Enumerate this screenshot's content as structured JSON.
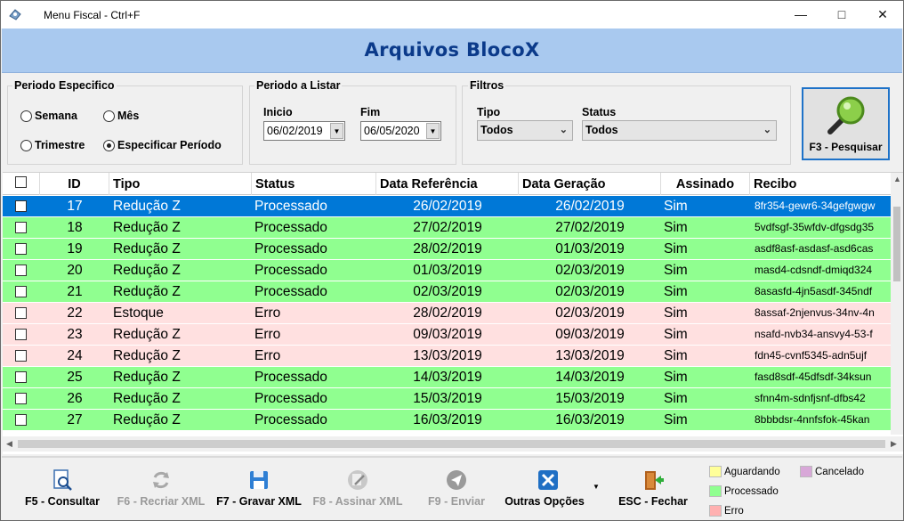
{
  "window": {
    "title": "Menu Fiscal - Ctrl+F",
    "controls": [
      "minimize",
      "maximize",
      "close"
    ]
  },
  "header": {
    "title": "Arquivos BlocoX"
  },
  "filters": {
    "periodo_especifico": {
      "label": "Periodo Especifico",
      "options": [
        {
          "label": "Semana",
          "checked": false
        },
        {
          "label": "Mês",
          "checked": false
        },
        {
          "label": "Trimestre",
          "checked": false
        },
        {
          "label": "Especificar Período",
          "checked": true
        }
      ]
    },
    "periodo_listar": {
      "label": "Periodo a Listar",
      "inicio_label": "Inicio",
      "inicio_value": "06/02/2019",
      "fim_label": "Fim",
      "fim_value": "06/05/2020"
    },
    "filtros": {
      "label": "Filtros",
      "tipo_label": "Tipo",
      "tipo_value": "Todos",
      "status_label": "Status",
      "status_value": "Todos"
    },
    "search_button": {
      "label": "F3 - Pesquisar",
      "icon": "magnifier-icon"
    }
  },
  "grid": {
    "columns": [
      "ID",
      "Tipo",
      "Status",
      "Data Referência",
      "Data Geração",
      "Assinado",
      "Recibo"
    ],
    "rows": [
      {
        "id": "17",
        "tipo": "Redução Z",
        "status": "Processado",
        "ref": "26/02/2019",
        "ger": "26/02/2019",
        "assinado": "Sim",
        "recibo": "8fr354-gewr6-34gefgwgw",
        "selected": true
      },
      {
        "id": "18",
        "tipo": "Redução Z",
        "status": "Processado",
        "ref": "27/02/2019",
        "ger": "27/02/2019",
        "assinado": "Sim",
        "recibo": "5vdfsgf-35wfdv-dfgsdg35"
      },
      {
        "id": "19",
        "tipo": "Redução Z",
        "status": "Processado",
        "ref": "28/02/2019",
        "ger": "01/03/2019",
        "assinado": "Sim",
        "recibo": "asdf8asf-asdasf-asd6cas"
      },
      {
        "id": "20",
        "tipo": "Redução Z",
        "status": "Processado",
        "ref": "01/03/2019",
        "ger": "02/03/2019",
        "assinado": "Sim",
        "recibo": "masd4-cdsndf-dmiqd324"
      },
      {
        "id": "21",
        "tipo": "Redução Z",
        "status": "Processado",
        "ref": "02/03/2019",
        "ger": "02/03/2019",
        "assinado": "Sim",
        "recibo": "8asasfd-4jn5asdf-345ndf"
      },
      {
        "id": "22",
        "tipo": "Estoque",
        "status": "Erro",
        "ref": "28/02/2019",
        "ger": "02/03/2019",
        "assinado": "Sim",
        "recibo": "8assaf-2njenvus-34nv-4n"
      },
      {
        "id": "23",
        "tipo": "Redução Z",
        "status": "Erro",
        "ref": "09/03/2019",
        "ger": "09/03/2019",
        "assinado": "Sim",
        "recibo": "nsafd-nvb34-ansvy4-53-f"
      },
      {
        "id": "24",
        "tipo": "Redução Z",
        "status": "Erro",
        "ref": "13/03/2019",
        "ger": "13/03/2019",
        "assinado": "Sim",
        "recibo": "fdn45-cvnf5345-adn5ujf"
      },
      {
        "id": "25",
        "tipo": "Redução Z",
        "status": "Processado",
        "ref": "14/03/2019",
        "ger": "14/03/2019",
        "assinado": "Sim",
        "recibo": "fasd8sdf-45dfsdf-34ksun"
      },
      {
        "id": "26",
        "tipo": "Redução Z",
        "status": "Processado",
        "ref": "15/03/2019",
        "ger": "15/03/2019",
        "assinado": "Sim",
        "recibo": "sfnn4m-sdnfjsnf-dfbs42"
      },
      {
        "id": "27",
        "tipo": "Redução Z",
        "status": "Processado",
        "ref": "16/03/2019",
        "ger": "16/03/2019",
        "assinado": "Sim",
        "recibo": "8bbbdsr-4nnfsfok-45kan"
      }
    ]
  },
  "colors": {
    "processado": "#90ff90",
    "erro": "#ffe0e0",
    "aguardando": "#ffff99",
    "cancelado": "#d8a8d8",
    "selected": "#0078d7",
    "header_band": "#a9c9ef",
    "title_text": "#0b3a8a"
  },
  "toolbar": {
    "buttons": [
      {
        "label": "F5 - Consultar",
        "icon": "document-search-icon",
        "enabled": true
      },
      {
        "label": "F6 - Recriar XML",
        "icon": "recycle-icon",
        "enabled": false
      },
      {
        "label": "F7 - Gravar XML",
        "icon": "floppy-disk-icon",
        "enabled": true
      },
      {
        "label": "F8 - Assinar XML",
        "icon": "sign-pen-icon",
        "enabled": false
      },
      {
        "label": "F9 - Enviar",
        "icon": "send-icon",
        "enabled": false
      },
      {
        "label": "Outras Opções",
        "icon": "tools-icon",
        "enabled": true
      },
      {
        "label": "ESC - Fechar",
        "icon": "exit-door-icon",
        "enabled": true
      }
    ]
  },
  "legend": [
    {
      "label": "Aguardando",
      "color": "#ffff99"
    },
    {
      "label": "Cancelado",
      "color": "#d8a8d8"
    },
    {
      "label": "Processado",
      "color": "#90ff90"
    },
    {
      "label": "Erro",
      "color": "#ffb0b0"
    }
  ]
}
